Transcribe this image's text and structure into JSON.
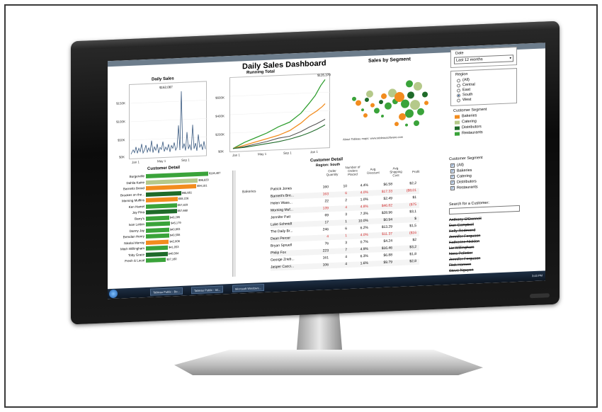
{
  "dashboard": {
    "window_title": "Tableau Public - ...",
    "title": "Daily Sales Dashboard",
    "daily_sales": {
      "title": "Daily Sales",
      "y_ticks": [
        "$150K",
        "$100K",
        "$50K",
        "$0K"
      ],
      "x_ticks": [
        "Jan 1",
        "May 1",
        "Sep 1"
      ],
      "peak_label": "$162,087"
    },
    "running_total": {
      "title": "Running Total",
      "y_ticks": [
        "$600K",
        "$400K",
        "$200K",
        "$0K"
      ],
      "x_ticks": [
        "Jan 1",
        "May 1",
        "Sep 1",
        "Jan 1"
      ],
      "peak_label": "$135,370"
    },
    "segments": {
      "title": "Sales by Segment",
      "credit": "About Tableau maps: www.tableausoftware.com"
    },
    "filters": {
      "date_label": "Date",
      "date_value": "Last 12 months",
      "region_label": "Region",
      "region_options": [
        "(All)",
        "Central",
        "East",
        "South",
        "West"
      ],
      "region_selected": 3,
      "segment_legend_label": "Customer Segment",
      "segment_legend": [
        {
          "name": "Bakeries",
          "color": "#f28c1e"
        },
        {
          "name": "Catering",
          "color": "#b5c98a"
        },
        {
          "name": "Distributors",
          "color": "#1f6b2a"
        },
        {
          "name": "Restaurants",
          "color": "#3aa33a"
        }
      ],
      "segment_filter_label": "Customer Segment",
      "segment_filter": [
        "(All)",
        "Bakeries",
        "Catering",
        "Distributors",
        "Restaurants"
      ],
      "search_label": "Search for a Customer:",
      "customers": [
        "Anthony O'Donnell",
        "Dan Campbell",
        "Kelly Redmond",
        "Jennifer Ferguson",
        "Katherine Nicklen",
        "Liz Willingham",
        "Nora Pelletier",
        "Jennifer Ferguson",
        "Rick Hansen",
        "Steve Nguyen"
      ]
    },
    "customer_bars": {
      "title": "Customer Detail",
      "rows": [
        {
          "name": "Burgerville",
          "label": "$116,487",
          "value": 116487,
          "color": "#3aa33a"
        },
        {
          "name": "Dahlia Kaine",
          "label": "$96,829",
          "value": 96829,
          "color": "#b5c98a"
        },
        {
          "name": "Barnetts Bread",
          "label": "$94,181",
          "value": 94181,
          "color": "#f28c1e"
        },
        {
          "name": "Brookes on the...",
          "label": "$65,661",
          "value": 65661,
          "color": "#1f6b2a"
        },
        {
          "name": "Morning Muffins",
          "label": "$59,226",
          "value": 59226,
          "color": "#f28c1e"
        },
        {
          "name": "Ken Hamel",
          "label": "$57,829",
          "value": 57829,
          "color": "#3aa33a"
        },
        {
          "name": "Jay Pina",
          "label": "$57,668",
          "value": 57668,
          "color": "#1f6b2a"
        },
        {
          "name": "Barry's",
          "label": "$43,285",
          "value": 43285,
          "color": "#3aa33a"
        },
        {
          "name": "Ivan Lotton",
          "label": "$45,179",
          "value": 45179,
          "color": "#3aa33a"
        },
        {
          "name": "Danny Jay",
          "label": "$43,603",
          "value": 43603,
          "color": "#3aa33a"
        },
        {
          "name": "Brendan Henry",
          "label": "$43,508",
          "value": 43508,
          "color": "#3aa33a"
        },
        {
          "name": "Nikolai Murray",
          "label": "$42,806",
          "value": 42806,
          "color": "#f28c1e"
        },
        {
          "name": "Mitch Willingham",
          "label": "$41,053",
          "value": 41053,
          "color": "#3aa33a"
        },
        {
          "name": "Toby Grace",
          "label": "$40,564",
          "value": 40564,
          "color": "#1f6b2a"
        },
        {
          "name": "Fresh & Local",
          "label": "$37,160",
          "value": 37160,
          "color": "#3aa33a"
        }
      ]
    },
    "detail_table": {
      "title": "Customer Detail",
      "subtitle": "Region: South",
      "headers": [
        "Order Quantity",
        "Number of Orders Placed",
        "Avg. Discount",
        "Avg. Shipping Cost",
        "Profit"
      ],
      "segment_label": "Bakeries",
      "rows": [
        {
          "name": "Patrick Jones",
          "qty": "160",
          "orders": "10",
          "disc": "4.4%",
          "ship": "$6.58",
          "profit": "$2,2",
          "neg": false
        },
        {
          "name": "Barnett's Bre...",
          "qty": "163",
          "orders": "6",
          "disc": "4.0%",
          "ship": "$17.33",
          "profit": "($8,01",
          "neg": true
        },
        {
          "name": "Helen Wass...",
          "qty": "22",
          "orders": "2",
          "disc": "1.0%",
          "ship": "$2.49",
          "profit": "$1",
          "neg": false
        },
        {
          "name": "Morning Muf...",
          "qty": "139",
          "orders": "4",
          "disc": "4.8%",
          "ship": "$46.82",
          "profit": "($75",
          "neg": true
        },
        {
          "name": "Jennifer Patt",
          "qty": "69",
          "orders": "3",
          "disc": "7.3%",
          "ship": "$28.96",
          "profit": "$3,1",
          "neg": false
        },
        {
          "name": "Luke Schmidt",
          "qty": "17",
          "orders": "1",
          "disc": "10.0%",
          "ship": "$0.94",
          "profit": "$",
          "neg": false
        },
        {
          "name": "The Daily Br...",
          "qty": "246",
          "orders": "6",
          "disc": "6.2%",
          "ship": "$13.29",
          "profit": "$1,5",
          "neg": false
        },
        {
          "name": "Dean Percer",
          "qty": "4",
          "orders": "1",
          "disc": "4.0%",
          "ship": "$11.37",
          "profit": "($16",
          "neg": true
        },
        {
          "name": "Bryan Spruell",
          "qty": "76",
          "orders": "3",
          "disc": "0.7%",
          "ship": "$4.24",
          "profit": "$2",
          "neg": false
        },
        {
          "name": "Philip Fox",
          "qty": "223",
          "orders": "7",
          "disc": "4.9%",
          "ship": "$16.46",
          "profit": "$3,2",
          "neg": false
        },
        {
          "name": "George Zrieb...",
          "qty": "161",
          "orders": "4",
          "disc": "6.3%",
          "ship": "$6.88",
          "profit": "$1,8",
          "neg": false
        },
        {
          "name": "Jasper Cacci...",
          "qty": "106",
          "orders": "4",
          "disc": "1.6%",
          "ship": "$9.79",
          "profit": "$2,8",
          "neg": false
        }
      ]
    },
    "taskbar": {
      "buttons": [
        "Tableau Public - Bo...",
        "Tableau Public - Ial...",
        "Microsoft Windows..."
      ],
      "clock": "3:43 PM"
    }
  }
}
